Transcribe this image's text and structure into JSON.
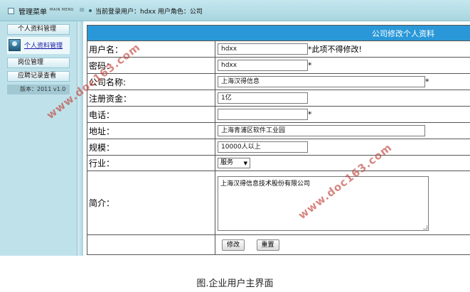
{
  "topbar": {
    "title": "管理菜单",
    "title_en": "MAIN MENU",
    "login_info": "当前登录用户：hdxx  用户角色：公司"
  },
  "sidebar": {
    "personal_group": "个人资料管理",
    "personal_link": "个人资料管理",
    "position_group": "岗位管理",
    "applications_group": "应聘记录查看",
    "version": "版本：2011 v1.0"
  },
  "form": {
    "header": "公司修改个人资料",
    "rows": [
      {
        "label": "用户名：",
        "value": "hdxx",
        "note": "*此项不得修改!"
      },
      {
        "label": "密码：",
        "value": "hdxx",
        "note": "*"
      },
      {
        "label": "公司名称:",
        "value": "上海汉得信息",
        "note": "*"
      },
      {
        "label": "注册资金：",
        "value": "1亿",
        "note": ""
      },
      {
        "label": "电话：",
        "value": "",
        "note": "*"
      },
      {
        "label": "地址：",
        "value": "上海青浦区软件工业园",
        "note": ""
      },
      {
        "label": "规模：",
        "value": "10000人以上",
        "note": ""
      },
      {
        "label": "行业：",
        "value": "服务",
        "note": ""
      },
      {
        "label": "简介：",
        "value": "上海汉得信息技术股份有限公司",
        "note": ""
      }
    ],
    "submit_label": "修改",
    "reset_label": "重置"
  },
  "caption": "图.企业用户主界面",
  "watermark": "www.doc163.com",
  "colors": {
    "header_bg": "#2a98d8",
    "sidebar_bg": "#bfe2ea",
    "watermark": "#c2473f"
  }
}
